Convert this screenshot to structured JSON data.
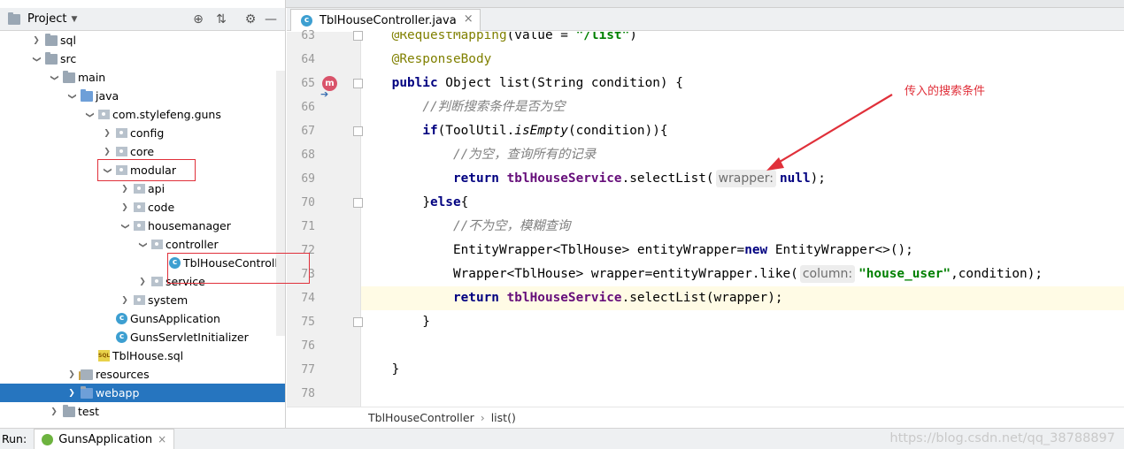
{
  "project_panel": {
    "title": "Project",
    "tree": [
      {
        "label": "sql",
        "depth": 2,
        "arrow": "right",
        "icon": "folder"
      },
      {
        "label": "src",
        "depth": 2,
        "arrow": "down",
        "icon": "folder"
      },
      {
        "label": "main",
        "depth": 3,
        "arrow": "down",
        "icon": "folder"
      },
      {
        "label": "java",
        "depth": 4,
        "arrow": "down",
        "icon": "src"
      },
      {
        "label": "com.stylefeng.guns",
        "depth": 5,
        "arrow": "down",
        "icon": "pkg"
      },
      {
        "label": "config",
        "depth": 6,
        "arrow": "right",
        "icon": "pkg"
      },
      {
        "label": "core",
        "depth": 6,
        "arrow": "right",
        "icon": "pkg"
      },
      {
        "label": "modular",
        "depth": 6,
        "arrow": "down",
        "icon": "pkg"
      },
      {
        "label": "api",
        "depth": 7,
        "arrow": "right",
        "icon": "pkg"
      },
      {
        "label": "code",
        "depth": 7,
        "arrow": "right",
        "icon": "pkg"
      },
      {
        "label": "housemanager",
        "depth": 7,
        "arrow": "down",
        "icon": "pkg"
      },
      {
        "label": "controller",
        "depth": 8,
        "arrow": "down",
        "icon": "pkg"
      },
      {
        "label": "TblHouseControlle",
        "depth": 9,
        "arrow": "none",
        "icon": "class"
      },
      {
        "label": "service",
        "depth": 8,
        "arrow": "right",
        "icon": "pkg"
      },
      {
        "label": "system",
        "depth": 7,
        "arrow": "right",
        "icon": "pkg"
      },
      {
        "label": "GunsApplication",
        "depth": 6,
        "arrow": "none",
        "icon": "class"
      },
      {
        "label": "GunsServletInitializer",
        "depth": 6,
        "arrow": "none",
        "icon": "class"
      },
      {
        "label": "TblHouse.sql",
        "depth": 5,
        "arrow": "none",
        "icon": "sql"
      },
      {
        "label": "resources",
        "depth": 4,
        "arrow": "right",
        "icon": "res"
      },
      {
        "label": "webapp",
        "depth": 4,
        "arrow": "right",
        "icon": "web",
        "selected": true
      },
      {
        "label": "test",
        "depth": 3,
        "arrow": "right",
        "icon": "folder"
      }
    ]
  },
  "editor": {
    "tab_label": "TblHouseController.java",
    "lines": [
      {
        "n": "63",
        "tokens": [
          {
            "t": "    "
          },
          {
            "t": "@RequestMapping",
            "c": "an"
          },
          {
            "t": "(value = "
          },
          {
            "t": "\"/list\"",
            "c": "strlit"
          },
          {
            "t": ")"
          }
        ]
      },
      {
        "n": "64",
        "tokens": [
          {
            "t": "    "
          },
          {
            "t": "@ResponseBody",
            "c": "an"
          }
        ]
      },
      {
        "n": "65",
        "tokens": [
          {
            "t": "    "
          },
          {
            "t": "public",
            "c": "kw"
          },
          {
            "t": " Object list(String condition) {"
          }
        ]
      },
      {
        "n": "66",
        "tokens": [
          {
            "t": "        "
          },
          {
            "t": "//判断搜索条件是否为空",
            "c": "cm"
          }
        ]
      },
      {
        "n": "67",
        "tokens": [
          {
            "t": "        "
          },
          {
            "t": "if",
            "c": "kw"
          },
          {
            "t": "(ToolUtil."
          },
          {
            "t": "isEmpty",
            "c": "fn"
          },
          {
            "t": "(condition)){"
          }
        ]
      },
      {
        "n": "68",
        "tokens": [
          {
            "t": "            "
          },
          {
            "t": "//为空，查询所有的记录",
            "c": "cm"
          }
        ]
      },
      {
        "n": "69",
        "tokens": [
          {
            "t": "            "
          },
          {
            "t": "return",
            "c": "kw"
          },
          {
            "t": " "
          },
          {
            "t": "tblHouseService",
            "c": "svc"
          },
          {
            "t": ".selectList("
          },
          {
            "t": "wrapper:",
            "c": "hint"
          },
          {
            "t": "null",
            "c": "kw"
          },
          {
            "t": ");"
          }
        ]
      },
      {
        "n": "70",
        "tokens": [
          {
            "t": "        "
          },
          {
            "t": "}"
          },
          {
            "t": "else",
            "c": "kw"
          },
          {
            "t": "{"
          }
        ]
      },
      {
        "n": "71",
        "tokens": [
          {
            "t": "            "
          },
          {
            "t": "//不为空，模糊查询",
            "c": "cm"
          }
        ]
      },
      {
        "n": "72",
        "tokens": [
          {
            "t": "            EntityWrapper<TblHouse> entityWrapper="
          },
          {
            "t": "new",
            "c": "kw"
          },
          {
            "t": " EntityWrapper<>();"
          }
        ]
      },
      {
        "n": "73",
        "tokens": [
          {
            "t": "            Wrapper<TblHouse> wrapper=entityWrapper.like("
          },
          {
            "t": "column:",
            "c": "hint"
          },
          {
            "t": "\"house_user\"",
            "c": "strlit"
          },
          {
            "t": ",condition);"
          }
        ]
      },
      {
        "n": "74",
        "tokens": [
          {
            "t": "            "
          },
          {
            "t": "return",
            "c": "kw"
          },
          {
            "t": " "
          },
          {
            "t": "tblHouseService",
            "c": "svc"
          },
          {
            "t": ".selectList(wrapper);"
          }
        ],
        "current": true
      },
      {
        "n": "75",
        "tokens": [
          {
            "t": "        }"
          }
        ]
      },
      {
        "n": "76",
        "tokens": []
      },
      {
        "n": "77",
        "tokens": [
          {
            "t": "    }"
          }
        ]
      },
      {
        "n": "78",
        "tokens": []
      }
    ],
    "breadcrumbs": [
      "TblHouseController",
      "list()"
    ]
  },
  "run_bar": {
    "label": "Run:",
    "tab_label": "GunsApplication"
  },
  "annotation": {
    "note": "传入的搜索条件"
  },
  "watermark": "https://blog.csdn.net/qq_38788897",
  "colors": {
    "selection": "#2675bf",
    "annotation_red": "#e0303a",
    "current_line": "#fffbe5"
  }
}
